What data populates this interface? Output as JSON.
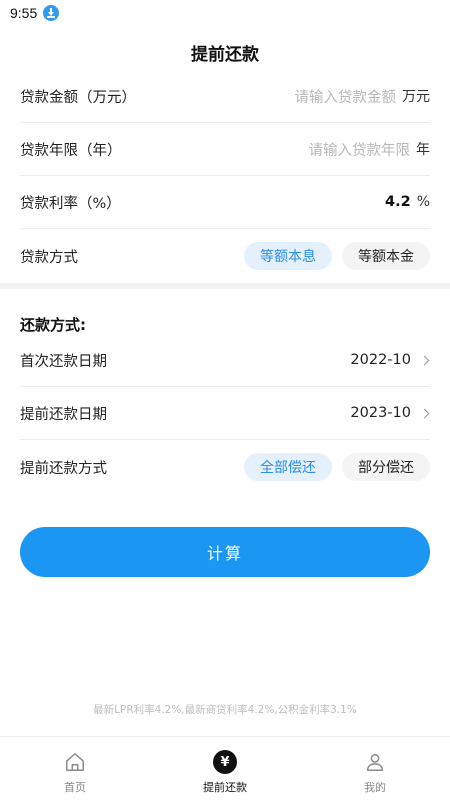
{
  "status_bar": {
    "time": "9:55"
  },
  "header": {
    "title": "提前还款"
  },
  "loan": {
    "amount_label": "贷款金额（万元）",
    "amount_placeholder": "请输入贷款金额",
    "amount_unit": "万元",
    "years_label": "贷款年限（年）",
    "years_placeholder": "请输入贷款年限",
    "years_unit": "年",
    "rate_label": "贷款利率（%）",
    "rate_value": "4.2",
    "rate_unit": "%",
    "method_label": "贷款方式",
    "method_options": [
      "等额本息",
      "等额本金"
    ],
    "method_selected": "等额本息"
  },
  "repay": {
    "section_title": "还款方式:",
    "first_date_label": "首次还款日期",
    "first_date_value": "2022-10",
    "prepay_date_label": "提前还款日期",
    "prepay_date_value": "2023-10",
    "prepay_method_label": "提前还款方式",
    "prepay_options": [
      "全部偿还",
      "部分偿还"
    ],
    "prepay_selected": "全部偿还"
  },
  "actions": {
    "calculate_label": "计算"
  },
  "footnote": "最新LPR利率4.2%,最新商贷利率4.2%,公积金利率3.1%",
  "tabbar": {
    "items": [
      {
        "label": "首页",
        "icon": "home-icon"
      },
      {
        "label": "提前还款",
        "icon": "yuan-icon"
      },
      {
        "label": "我的",
        "icon": "person-icon"
      }
    ],
    "active": "提前还款"
  },
  "colors": {
    "accent": "#1b96f3",
    "pill_active_bg": "#e4f1fd",
    "pill_active_text": "#2b8be6",
    "pill_inactive_bg": "#f4f4f4"
  }
}
